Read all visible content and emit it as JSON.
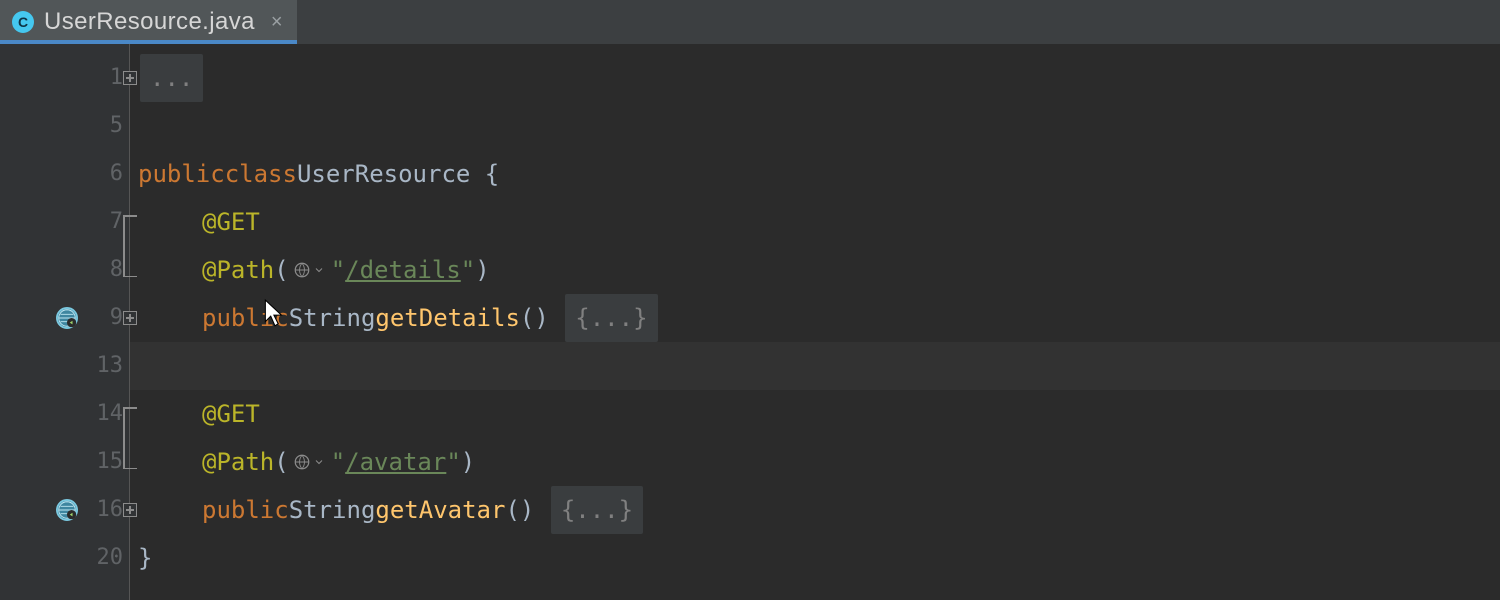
{
  "tab": {
    "icon_letter": "C",
    "title": "UserResource.java"
  },
  "lines": {
    "l1": {
      "no": "1"
    },
    "l5": {
      "no": "5"
    },
    "l6": {
      "no": "6",
      "kw_public": "public",
      "kw_class": "class",
      "cls": "UserResource",
      "open": " {"
    },
    "l7": {
      "no": "7",
      "anno": "@GET"
    },
    "l8": {
      "no": "8",
      "anno": "@Path",
      "open": "(",
      "str": "\"",
      "path": "/details",
      "strend": "\"",
      "close": ")"
    },
    "l9": {
      "no": "9",
      "kw_public": "public",
      "type": "String",
      "fn": "getDetails",
      "parens": "()",
      "sp": " ",
      "fold": "{...}"
    },
    "l13": {
      "no": "13"
    },
    "l14": {
      "no": "14",
      "anno": "@GET"
    },
    "l15": {
      "no": "15",
      "anno": "@Path",
      "open": "(",
      "str": "\"",
      "path": "/avatar",
      "strend": "\"",
      "close": ")"
    },
    "l16": {
      "no": "16",
      "kw_public": "public",
      "type": "String",
      "fn": "getAvatar",
      "parens": "()",
      "sp": " ",
      "fold": "{...}"
    },
    "l20": {
      "no": "20",
      "close": "}"
    }
  },
  "fold_ellipsis_top": "..."
}
